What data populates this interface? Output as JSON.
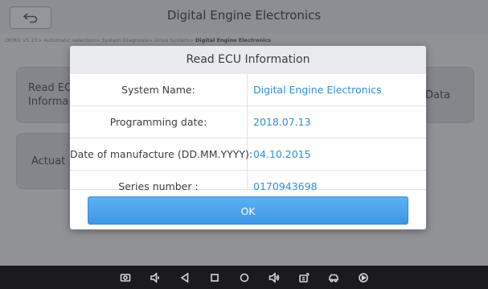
{
  "header": {
    "title": "Digital Engine Electronics",
    "back_icon": "back-arrow-icon"
  },
  "breadcrumb": {
    "path": "DEMO V5.23> Automatic selection> System Diagnosis> Drive System> ",
    "current": "Digital Engine Electronics"
  },
  "tiles": {
    "read_ecu_partial": "Read EC Informa",
    "data_partial": "Data",
    "actuation_partial": "Actuat"
  },
  "dialog": {
    "title": "Read ECU Information",
    "rows": [
      {
        "label": "System Name:",
        "value": "Digital Engine Electronics"
      },
      {
        "label": "Programming date:",
        "value": "2018.07.13"
      },
      {
        "label": "Date of manufacture (DD.MM.YYYY):",
        "value": "04.10.2015"
      },
      {
        "label": "Series number :",
        "value": "0170943698"
      }
    ],
    "ok_label": "OK"
  },
  "navbar": {
    "icons": [
      "screenshot-icon",
      "volume-down-icon",
      "back-triangle-icon",
      "recent-apps-icon",
      "home-circle-icon",
      "volume-up-icon",
      "vci-icon",
      "car-icon",
      "record-icon"
    ]
  },
  "colors": {
    "accent": "#2f8fd8",
    "button": "#3e97e6",
    "navbar": "#1b1b1d"
  }
}
